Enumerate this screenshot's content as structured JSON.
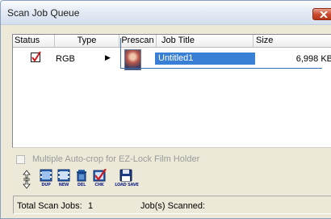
{
  "window": {
    "title": "Scan Job Queue",
    "close_icon": "close-icon"
  },
  "table": {
    "columns": [
      "Status",
      "Type",
      "Prescan",
      "Job Title",
      "Size"
    ],
    "rows": [
      {
        "status": "checked",
        "type": "RGB",
        "prescan": "thumbnail-image",
        "job_title": "Untitled1",
        "size": "6,998 KB",
        "selected": true
      }
    ]
  },
  "options": {
    "autocrop_label": "Multiple Auto-crop for EZ-Lock Film Holder",
    "autocrop_checked": false,
    "autocrop_enabled": false
  },
  "toolbar": {
    "buttons": [
      {
        "caption": "DUP",
        "icon": "duplicate-film-icon"
      },
      {
        "caption": "NEW",
        "icon": "new-film-icon"
      },
      {
        "caption": "DEL",
        "icon": "trash-icon"
      },
      {
        "caption": "CHK",
        "icon": "check-icon"
      },
      {
        "caption": "LOAD SAVE",
        "icon": "floppy-disk-icon"
      }
    ]
  },
  "status": {
    "total_label": "Total Scan Jobs:",
    "total_value": "1",
    "scanned_label": "Job(s) Scanned:"
  },
  "colors": {
    "accent": "#3a7fd6",
    "check": "#d01818",
    "connector": "#3d6fb4"
  }
}
